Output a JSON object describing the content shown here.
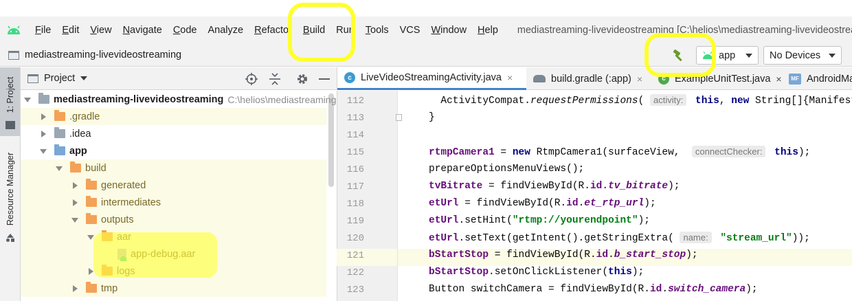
{
  "menubar": {
    "items": [
      {
        "label": "File",
        "mnemonic": "F",
        "rest": "ile"
      },
      {
        "label": "Edit",
        "mnemonic": "E",
        "rest": "dit"
      },
      {
        "label": "View",
        "mnemonic": "V",
        "rest": "iew"
      },
      {
        "label": "Navigate",
        "mnemonic": "N",
        "rest": "avigate"
      },
      {
        "label": "Code",
        "mnemonic": "C",
        "rest": "ode"
      },
      {
        "label": "Analyze",
        "mnemonic": "",
        "rest": "Analyze"
      },
      {
        "label": "Refactor",
        "mnemonic": "R",
        "rest": "efactor"
      },
      {
        "label": "Build",
        "mnemonic": "B",
        "rest": "uild"
      },
      {
        "label": "Run",
        "mnemonic": "",
        "rest": "Run"
      },
      {
        "label": "Tools",
        "mnemonic": "T",
        "rest": "ools"
      },
      {
        "label": "VCS",
        "mnemonic": "",
        "rest": "VCS"
      },
      {
        "label": "Window",
        "mnemonic": "W",
        "rest": "indow"
      },
      {
        "label": "Help",
        "mnemonic": "H",
        "rest": "elp"
      }
    ],
    "project_title": "mediastreaming-livevideostreaming [C:\\helios\\mediastreaming-livevideostreaming"
  },
  "navbar": {
    "project_name": "mediastreaming-livevideostreaming",
    "run_config": "app",
    "device": "No Devices",
    "build_icon": "hammer-icon"
  },
  "toolstrip": {
    "project_tab": "1: Project",
    "resource_tab": "Resource Manager"
  },
  "project_panel": {
    "title": "Project",
    "tree": [
      {
        "label": "mediastreaming-livevideostreaming",
        "path": "C:\\helios\\mediastreaming-livevideostreaming",
        "depth": 0,
        "arrow": "down",
        "icon": "gray",
        "bold": true,
        "highlight": false
      },
      {
        "label": ".gradle",
        "path": "",
        "depth": 1,
        "arrow": "right",
        "icon": "orange",
        "bold": false,
        "highlight": true
      },
      {
        "label": ".idea",
        "path": "",
        "depth": 1,
        "arrow": "right",
        "icon": "gray",
        "bold": false,
        "highlight": false
      },
      {
        "label": "app",
        "path": "",
        "depth": 1,
        "arrow": "down",
        "icon": "blue",
        "bold": true,
        "highlight": false
      },
      {
        "label": "build",
        "path": "",
        "depth": 2,
        "arrow": "down",
        "icon": "orange",
        "bold": false,
        "highlight": true
      },
      {
        "label": "generated",
        "path": "",
        "depth": 3,
        "arrow": "right",
        "icon": "orange",
        "bold": false,
        "highlight": true
      },
      {
        "label": "intermediates",
        "path": "",
        "depth": 3,
        "arrow": "right",
        "icon": "orange",
        "bold": false,
        "highlight": true
      },
      {
        "label": "outputs",
        "path": "",
        "depth": 3,
        "arrow": "down",
        "icon": "orange",
        "bold": false,
        "highlight": true
      },
      {
        "label": "aar",
        "path": "",
        "depth": 4,
        "arrow": "down",
        "icon": "orange",
        "bold": false,
        "highlight": true
      },
      {
        "label": "app-debug.aar",
        "path": "",
        "depth": 5,
        "arrow": "",
        "icon": "file",
        "bold": false,
        "highlight": true
      },
      {
        "label": "logs",
        "path": "",
        "depth": 4,
        "arrow": "right",
        "icon": "orange",
        "bold": false,
        "highlight": true
      },
      {
        "label": "tmp",
        "path": "",
        "depth": 3,
        "arrow": "right",
        "icon": "orange",
        "bold": false,
        "highlight": true
      }
    ]
  },
  "editor": {
    "tabs": [
      {
        "label": "LiveVideoStreamingActivity.java",
        "icon": "c",
        "active": true
      },
      {
        "label": "build.gradle (:app)",
        "icon": "gradle",
        "active": false
      },
      {
        "label": "ExampleUnitTest.java",
        "icon": "test",
        "active": false
      },
      {
        "label": "AndroidManifest.xml",
        "icon": "mf",
        "active": false
      }
    ],
    "current_line": 121,
    "lines": [
      {
        "num": "112",
        "code": "  ActivityCompat.<i>requestPermissions</i>( <h>activity:</h> <k>this</k>, <k>new</k> String[]{Manifest"
      },
      {
        "num": "113",
        "code": "}"
      },
      {
        "num": "114",
        "code": ""
      },
      {
        "num": "115",
        "code": "<f>rtmpCamera1</f> = <k>new</k> RtmpCamera1(surfaceView,  <h>connectChecker:</h> <k>this</k>);"
      },
      {
        "num": "116",
        "code": "prepareOptionsMenuViews();"
      },
      {
        "num": "117",
        "code": "<f>tvBitrate</f> = findViewById(R.<f>id</f>.<fi>tv_bitrate</fi>);"
      },
      {
        "num": "118",
        "code": "<f>etUrl</f> = findViewById(R.<f>id</f>.<fi>et_rtp_url</fi>);"
      },
      {
        "num": "119",
        "code": "<f>etUrl</f>.setHint(<s>\"rtmp://yourendpoint\"</s>);"
      },
      {
        "num": "120",
        "code": "<f>etUrl</f>.setText(getIntent().getStringExtra( <h>name:</h> <s>\"stream_url\"</s>));"
      },
      {
        "num": "121",
        "code": "<f>bStartStop</f> = findViewById(R.<f>id</f>.<fi>b_start_stop</fi>);"
      },
      {
        "num": "122",
        "code": "<f>bStartStop</f>.setOnClickListener(<k>this</k>);"
      },
      {
        "num": "123",
        "code": "Button switchCamera = findViewById(R.<f>id</f>.<fi>switch_camera</fi>);"
      }
    ]
  },
  "colors": {
    "annotation": "#ffff2e",
    "android_green": "#3ddc84",
    "keyword": "#000080",
    "field": "#660e7a",
    "string": "#067d17"
  }
}
